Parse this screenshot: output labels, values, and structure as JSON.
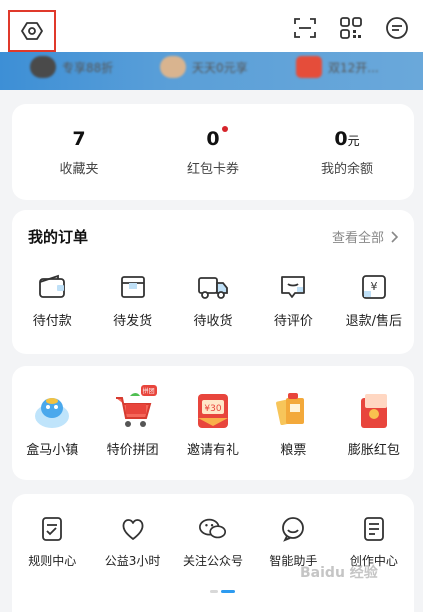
{
  "promo": {
    "item1": "专享88折",
    "item2": "天天0元享",
    "item3": "双12开..."
  },
  "stats": [
    {
      "value": "7",
      "unit": "",
      "label": "收藏夹"
    },
    {
      "value": "0",
      "unit": "",
      "label": "红包卡券"
    },
    {
      "value": "0",
      "unit": "元",
      "label": "我的余额"
    }
  ],
  "orders": {
    "title": "我的订单",
    "view_all": "查看全部",
    "items": [
      {
        "label": "待付款",
        "icon": "wallet-icon"
      },
      {
        "label": "待发货",
        "icon": "box-icon"
      },
      {
        "label": "待收货",
        "icon": "truck-icon"
      },
      {
        "label": "待评价",
        "icon": "comment-icon"
      },
      {
        "label": "退款/售后",
        "icon": "refund-icon"
      }
    ]
  },
  "services": [
    {
      "label": "盒马小镇",
      "icon": "hema-town-icon"
    },
    {
      "label": "特价拼团",
      "icon": "group-buy-cart-icon",
      "badge": "拼团"
    },
    {
      "label": "邀请有礼",
      "icon": "invite-gift-icon",
      "badge_text": "¥30"
    },
    {
      "label": "粮票",
      "icon": "food-ticket-icon"
    },
    {
      "label": "膨胀红包",
      "icon": "red-packet-icon"
    }
  ],
  "tools": [
    {
      "label": "规则中心",
      "icon": "rules-icon"
    },
    {
      "label": "公益3小时",
      "icon": "charity-icon"
    },
    {
      "label": "关注公众号",
      "icon": "wechat-icon"
    },
    {
      "label": "智能助手",
      "icon": "assistant-icon"
    },
    {
      "label": "创作中心",
      "icon": "creator-icon"
    }
  ],
  "watermark": "Baidu 经验",
  "colors": {
    "accent_red": "#d6242b",
    "highlight_box": "#e0392b",
    "promo_blue": "#3d8fd6",
    "pager_active": "#2d9bf0"
  }
}
